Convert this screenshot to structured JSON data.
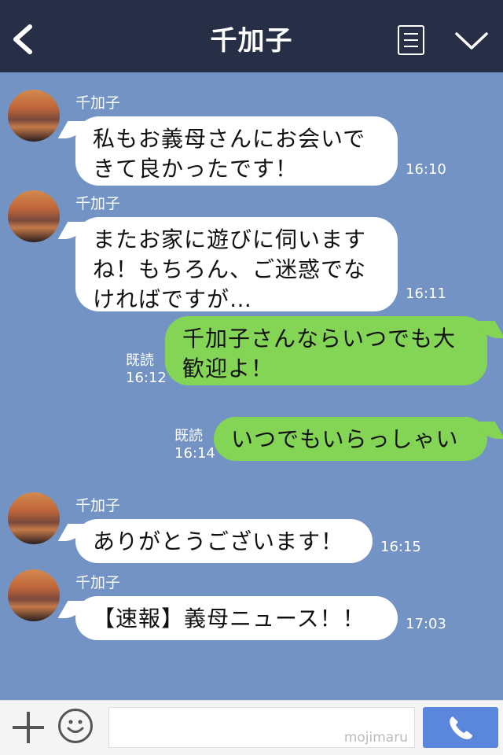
{
  "header": {
    "title": "千加子",
    "back_icon": "chevron-left-icon",
    "menu_icon": "menu-list-icon",
    "collapse_icon": "chevron-down-icon"
  },
  "messages": [
    {
      "sender": "千加子",
      "lines": [
        "私もお義母さんにお会いで",
        "きて良かったです！"
      ],
      "time": "16:10"
    },
    {
      "sender": "千加子",
      "lines": [
        "またお家に遊びに伺います",
        "ね！もちろん、ご迷惑でな",
        "ければですが…"
      ],
      "time": "16:11"
    },
    {
      "read": "既読",
      "lines": [
        "千加子さんならいつでも大",
        "歓迎よ！"
      ],
      "time": "16:12"
    },
    {
      "read": "既読",
      "lines": [
        "いつでもいらっしゃい"
      ],
      "time": "16:14"
    },
    {
      "sender": "千加子",
      "lines": [
        "ありがとうございます！"
      ],
      "time": "16:15"
    },
    {
      "sender": "千加子",
      "lines": [
        "【速報】義母ニュース！！"
      ],
      "time": "17:03"
    }
  ],
  "inputbar": {
    "watermark": "mojimaru",
    "plus_icon": "plus-icon",
    "sticker_icon": "smiley-icon",
    "call_icon": "phone-icon"
  },
  "colors": {
    "header_bg": "#262f46",
    "chat_bg": "#7293c3",
    "incoming_bubble": "#ffffff",
    "outgoing_bubble": "#84d455",
    "call_button": "#5a86dc"
  }
}
